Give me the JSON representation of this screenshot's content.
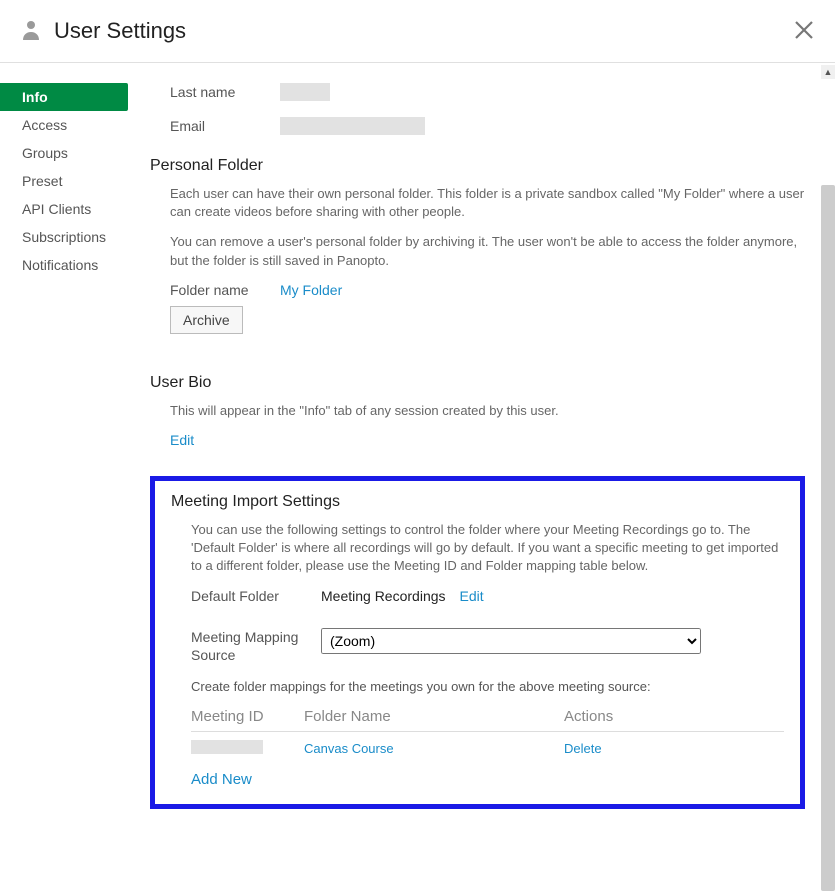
{
  "header": {
    "title": "User Settings"
  },
  "sidebar": {
    "items": [
      {
        "label": "Info"
      },
      {
        "label": "Access"
      },
      {
        "label": "Groups"
      },
      {
        "label": "Preset"
      },
      {
        "label": "API Clients"
      },
      {
        "label": "Subscriptions"
      },
      {
        "label": "Notifications"
      }
    ]
  },
  "fields": {
    "lastname_label": "Last name",
    "email_label": "Email"
  },
  "personal_folder": {
    "title": "Personal Folder",
    "p1": "Each user can have their own personal folder. This folder is a private sandbox called \"My Folder\" where a user can create videos before sharing with other people.",
    "p2": "You can remove a user's personal folder by archiving it. The user won't be able to access the folder anymore, but the folder is still saved in Panopto.",
    "folder_label": "Folder name",
    "folder_link": "My Folder",
    "archive_btn": "Archive"
  },
  "user_bio": {
    "title": "User Bio",
    "p1": "This will appear in the \"Info\" tab of any session created by this user.",
    "edit": "Edit"
  },
  "meeting": {
    "title": "Meeting Import Settings",
    "p1": "You can use the following settings to control the folder where your Meeting Recordings go to. The 'Default Folder' is where all recordings will go by default. If you want a specific meeting to get imported to a different folder, please use the Meeting ID and Folder mapping table below.",
    "default_folder_label": "Default Folder",
    "default_folder_value": "Meeting Recordings",
    "edit": "Edit",
    "mapping_source_label": "Meeting Mapping Source",
    "mapping_source_value": "(Zoom)",
    "mapping_help": "Create folder mappings for the meetings you own for the above meeting source:",
    "col_id": "Meeting ID",
    "col_folder": "Folder Name",
    "col_actions": "Actions",
    "row_folder": "Canvas Course",
    "row_delete": "Delete",
    "add_new": "Add New"
  }
}
